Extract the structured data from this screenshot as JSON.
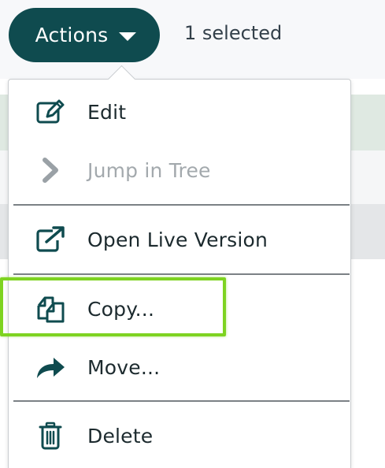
{
  "toolbar": {
    "actions_label": "Actions",
    "selection_status": "1 selected"
  },
  "colors": {
    "accent": "#0f4b4f",
    "highlight": "#7ed321",
    "disabled_text": "#a3a9ad"
  },
  "menu": {
    "items": [
      {
        "label": "Edit",
        "icon": "edit-icon",
        "enabled": true
      },
      {
        "label": "Jump in Tree",
        "icon": "chevron-right-icon",
        "enabled": false
      },
      {
        "label": "Open Live Version",
        "icon": "external-link-icon",
        "enabled": true
      },
      {
        "label": "Copy...",
        "icon": "copy-icon",
        "enabled": true
      },
      {
        "label": "Move...",
        "icon": "move-arrow-icon",
        "enabled": true
      },
      {
        "label": "Delete",
        "icon": "trash-icon",
        "enabled": true
      }
    ]
  }
}
